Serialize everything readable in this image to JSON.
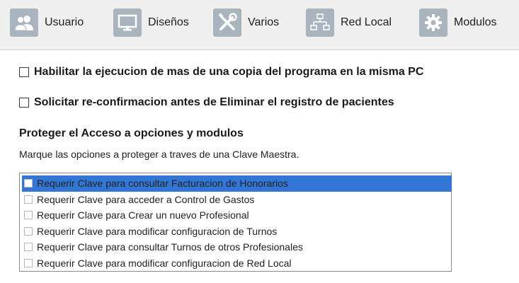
{
  "toolbar": {
    "tabs": [
      {
        "label": "Usuario",
        "icon": "users-icon"
      },
      {
        "label": "Diseños",
        "icon": "monitor-icon"
      },
      {
        "label": "Varios",
        "icon": "tools-icon"
      },
      {
        "label": "Red Local",
        "icon": "network-icon"
      },
      {
        "label": "Modulos",
        "icon": "gear-icon"
      }
    ]
  },
  "options": {
    "multi_instance": {
      "label": "Habilitar la ejecucion de mas de una copia del programa en la misma PC",
      "checked": false
    },
    "confirm_delete": {
      "label": "Solicitar re-confirmacion antes de Eliminar el registro de pacientes",
      "checked": false
    }
  },
  "protection": {
    "title": "Proteger el Acceso a opciones y modulos",
    "description": "Marque las opciones a proteger a traves de una Clave Maestra.",
    "items": [
      {
        "label": "Requerir Clave para consultar Facturacion de Honorarios",
        "checked": false,
        "selected": true
      },
      {
        "label": "Requerir Clave para acceder a Control de Gastos",
        "checked": false,
        "selected": false
      },
      {
        "label": "Requerir Clave para Crear un nuevo Profesional",
        "checked": false,
        "selected": false
      },
      {
        "label": "Requerir Clave para modificar configuracion de Turnos",
        "checked": false,
        "selected": false
      },
      {
        "label": "Requerir Clave para consultar Turnos de otros Profesionales",
        "checked": false,
        "selected": false
      },
      {
        "label": "Requerir Clave para modificar configuracion de Red Local",
        "checked": false,
        "selected": false
      }
    ]
  },
  "colors": {
    "toolbar_bg": "#f0f0f0",
    "icon_bg": "#aab4be",
    "selection": "#3377d6"
  }
}
